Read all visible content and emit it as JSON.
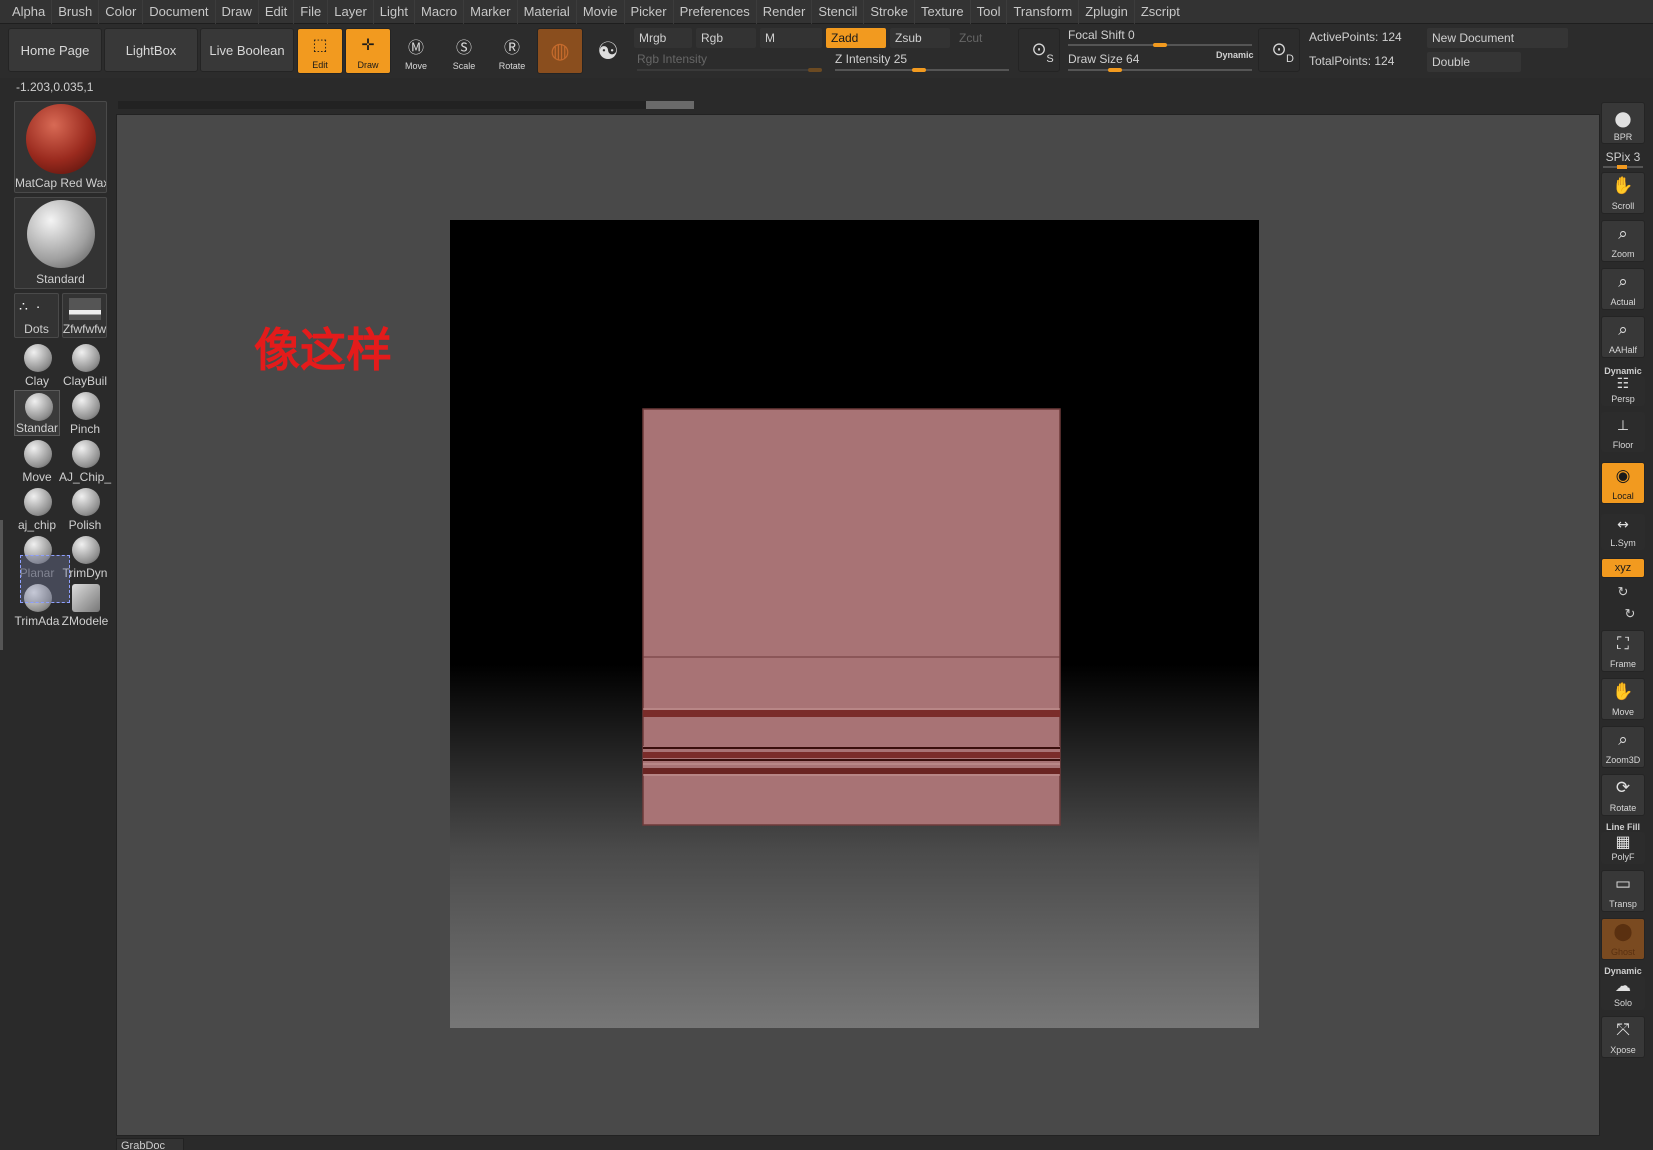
{
  "menu": [
    "Alpha",
    "Brush",
    "Color",
    "Document",
    "Draw",
    "Edit",
    "File",
    "Layer",
    "Light",
    "Macro",
    "Marker",
    "Material",
    "Movie",
    "Picker",
    "Preferences",
    "Render",
    "Stencil",
    "Stroke",
    "Texture",
    "Tool",
    "Transform",
    "Zplugin",
    "Zscript"
  ],
  "toolbar": {
    "home_page": "Home Page",
    "lightbox": "LightBox",
    "live_boolean": "Live Boolean",
    "edit": "Edit",
    "draw": "Draw",
    "move": "Move",
    "scale": "Scale",
    "rotate": "Rotate",
    "mrgb": "Mrgb",
    "rgb": "Rgb",
    "m": "M",
    "rgb_intensity": "Rgb Intensity",
    "zadd": "Zadd",
    "zsub": "Zsub",
    "zcut": "Zcut",
    "z_intensity_label": "Z Intensity",
    "z_intensity_value": "25",
    "focal_shift_label": "Focal Shift",
    "focal_shift_value": "0",
    "draw_size_label": "Draw Size",
    "draw_size_value": "64",
    "dynamic": "Dynamic",
    "active_points": "ActivePoints: 124",
    "total_points": "TotalPoints: 124",
    "new_document": "New Document",
    "double": "Double",
    "s_letter": "S",
    "d_letter": "D"
  },
  "coords": "-1.203,0.035,1",
  "left_shelf": {
    "material": "MatCap Red Wax",
    "brush_main": "Standard",
    "stroke": "Dots",
    "alpha": "Zfwfwfw",
    "brushes": [
      "Clay",
      "ClayBuil",
      "Standar",
      "Pinch",
      "Move",
      "AJ_Chip_",
      "aj_chip",
      "Polish",
      "Planar",
      "TrimDyn",
      "TrimAda",
      "ZModele"
    ]
  },
  "canvas": {
    "annotation": "像这样",
    "tab_label": "GrabDoc"
  },
  "right_shelf": {
    "bpr": "BPR",
    "spix": "SPix 3",
    "scroll": "Scroll",
    "zoom": "Zoom",
    "actual": "Actual",
    "aahalf": "AAHalf",
    "dynamic": "Dynamic",
    "persp": "Persp",
    "floor": "Floor",
    "local": "Local",
    "lsym": "L.Sym",
    "xyz": "xyz",
    "frame": "Frame",
    "move": "Move",
    "zoom3d": "Zoom3D",
    "rotate": "Rotate",
    "line_fill": "Line Fill",
    "polyf": "PolyF",
    "transp": "Transp",
    "ghost": "Ghost",
    "dynamic2": "Dynamic",
    "solo": "Solo",
    "xpose": "Xpose"
  },
  "colors": {
    "accent": "#f29a1f",
    "mesh": "#a87375",
    "annotation": "#e41b1b"
  }
}
